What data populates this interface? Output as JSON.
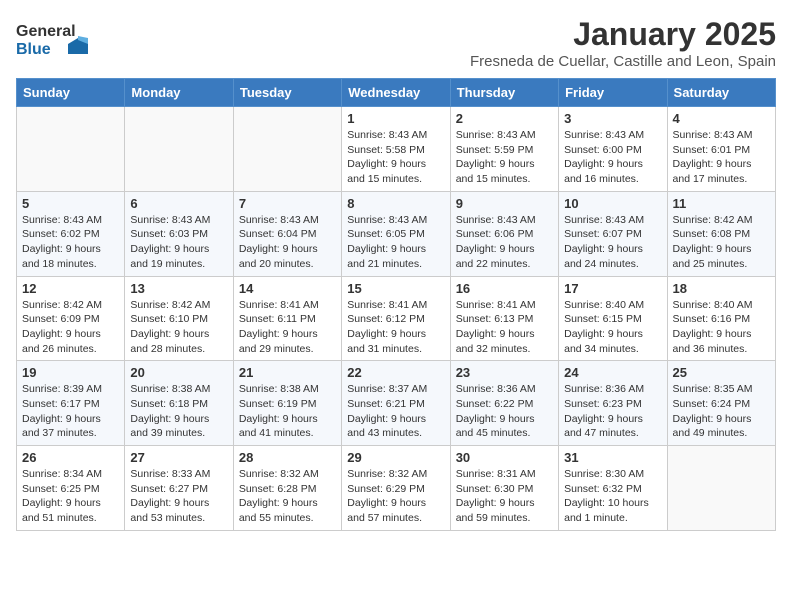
{
  "logo": {
    "line1": "General",
    "line2": "Blue"
  },
  "title": "January 2025",
  "location": "Fresneda de Cuellar, Castille and Leon, Spain",
  "weekdays": [
    "Sunday",
    "Monday",
    "Tuesday",
    "Wednesday",
    "Thursday",
    "Friday",
    "Saturday"
  ],
  "weeks": [
    [
      {
        "day": "",
        "info": ""
      },
      {
        "day": "",
        "info": ""
      },
      {
        "day": "",
        "info": ""
      },
      {
        "day": "1",
        "info": "Sunrise: 8:43 AM\nSunset: 5:58 PM\nDaylight: 9 hours\nand 15 minutes."
      },
      {
        "day": "2",
        "info": "Sunrise: 8:43 AM\nSunset: 5:59 PM\nDaylight: 9 hours\nand 15 minutes."
      },
      {
        "day": "3",
        "info": "Sunrise: 8:43 AM\nSunset: 6:00 PM\nDaylight: 9 hours\nand 16 minutes."
      },
      {
        "day": "4",
        "info": "Sunrise: 8:43 AM\nSunset: 6:01 PM\nDaylight: 9 hours\nand 17 minutes."
      }
    ],
    [
      {
        "day": "5",
        "info": "Sunrise: 8:43 AM\nSunset: 6:02 PM\nDaylight: 9 hours\nand 18 minutes."
      },
      {
        "day": "6",
        "info": "Sunrise: 8:43 AM\nSunset: 6:03 PM\nDaylight: 9 hours\nand 19 minutes."
      },
      {
        "day": "7",
        "info": "Sunrise: 8:43 AM\nSunset: 6:04 PM\nDaylight: 9 hours\nand 20 minutes."
      },
      {
        "day": "8",
        "info": "Sunrise: 8:43 AM\nSunset: 6:05 PM\nDaylight: 9 hours\nand 21 minutes."
      },
      {
        "day": "9",
        "info": "Sunrise: 8:43 AM\nSunset: 6:06 PM\nDaylight: 9 hours\nand 22 minutes."
      },
      {
        "day": "10",
        "info": "Sunrise: 8:43 AM\nSunset: 6:07 PM\nDaylight: 9 hours\nand 24 minutes."
      },
      {
        "day": "11",
        "info": "Sunrise: 8:42 AM\nSunset: 6:08 PM\nDaylight: 9 hours\nand 25 minutes."
      }
    ],
    [
      {
        "day": "12",
        "info": "Sunrise: 8:42 AM\nSunset: 6:09 PM\nDaylight: 9 hours\nand 26 minutes."
      },
      {
        "day": "13",
        "info": "Sunrise: 8:42 AM\nSunset: 6:10 PM\nDaylight: 9 hours\nand 28 minutes."
      },
      {
        "day": "14",
        "info": "Sunrise: 8:41 AM\nSunset: 6:11 PM\nDaylight: 9 hours\nand 29 minutes."
      },
      {
        "day": "15",
        "info": "Sunrise: 8:41 AM\nSunset: 6:12 PM\nDaylight: 9 hours\nand 31 minutes."
      },
      {
        "day": "16",
        "info": "Sunrise: 8:41 AM\nSunset: 6:13 PM\nDaylight: 9 hours\nand 32 minutes."
      },
      {
        "day": "17",
        "info": "Sunrise: 8:40 AM\nSunset: 6:15 PM\nDaylight: 9 hours\nand 34 minutes."
      },
      {
        "day": "18",
        "info": "Sunrise: 8:40 AM\nSunset: 6:16 PM\nDaylight: 9 hours\nand 36 minutes."
      }
    ],
    [
      {
        "day": "19",
        "info": "Sunrise: 8:39 AM\nSunset: 6:17 PM\nDaylight: 9 hours\nand 37 minutes."
      },
      {
        "day": "20",
        "info": "Sunrise: 8:38 AM\nSunset: 6:18 PM\nDaylight: 9 hours\nand 39 minutes."
      },
      {
        "day": "21",
        "info": "Sunrise: 8:38 AM\nSunset: 6:19 PM\nDaylight: 9 hours\nand 41 minutes."
      },
      {
        "day": "22",
        "info": "Sunrise: 8:37 AM\nSunset: 6:21 PM\nDaylight: 9 hours\nand 43 minutes."
      },
      {
        "day": "23",
        "info": "Sunrise: 8:36 AM\nSunset: 6:22 PM\nDaylight: 9 hours\nand 45 minutes."
      },
      {
        "day": "24",
        "info": "Sunrise: 8:36 AM\nSunset: 6:23 PM\nDaylight: 9 hours\nand 47 minutes."
      },
      {
        "day": "25",
        "info": "Sunrise: 8:35 AM\nSunset: 6:24 PM\nDaylight: 9 hours\nand 49 minutes."
      }
    ],
    [
      {
        "day": "26",
        "info": "Sunrise: 8:34 AM\nSunset: 6:25 PM\nDaylight: 9 hours\nand 51 minutes."
      },
      {
        "day": "27",
        "info": "Sunrise: 8:33 AM\nSunset: 6:27 PM\nDaylight: 9 hours\nand 53 minutes."
      },
      {
        "day": "28",
        "info": "Sunrise: 8:32 AM\nSunset: 6:28 PM\nDaylight: 9 hours\nand 55 minutes."
      },
      {
        "day": "29",
        "info": "Sunrise: 8:32 AM\nSunset: 6:29 PM\nDaylight: 9 hours\nand 57 minutes."
      },
      {
        "day": "30",
        "info": "Sunrise: 8:31 AM\nSunset: 6:30 PM\nDaylight: 9 hours\nand 59 minutes."
      },
      {
        "day": "31",
        "info": "Sunrise: 8:30 AM\nSunset: 6:32 PM\nDaylight: 10 hours\nand 1 minute."
      },
      {
        "day": "",
        "info": ""
      }
    ]
  ]
}
